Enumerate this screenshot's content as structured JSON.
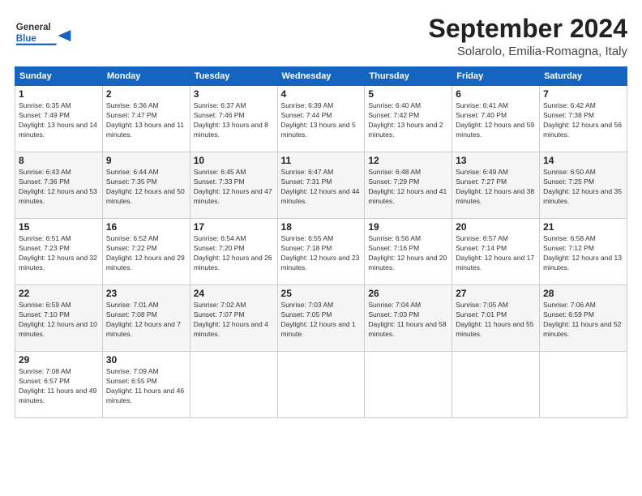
{
  "header": {
    "logo_general": "General",
    "logo_blue": "Blue",
    "month_title": "September 2024",
    "location": "Solarolo, Emilia-Romagna, Italy"
  },
  "weekdays": [
    "Sunday",
    "Monday",
    "Tuesday",
    "Wednesday",
    "Thursday",
    "Friday",
    "Saturday"
  ],
  "weeks": [
    [
      {
        "day": "1",
        "sunrise": "6:35 AM",
        "sunset": "7:49 PM",
        "daylight": "13 hours and 14 minutes."
      },
      {
        "day": "2",
        "sunrise": "6:36 AM",
        "sunset": "7:47 PM",
        "daylight": "13 hours and 11 minutes."
      },
      {
        "day": "3",
        "sunrise": "6:37 AM",
        "sunset": "7:46 PM",
        "daylight": "13 hours and 8 minutes."
      },
      {
        "day": "4",
        "sunrise": "6:39 AM",
        "sunset": "7:44 PM",
        "daylight": "13 hours and 5 minutes."
      },
      {
        "day": "5",
        "sunrise": "6:40 AM",
        "sunset": "7:42 PM",
        "daylight": "13 hours and 2 minutes."
      },
      {
        "day": "6",
        "sunrise": "6:41 AM",
        "sunset": "7:40 PM",
        "daylight": "12 hours and 59 minutes."
      },
      {
        "day": "7",
        "sunrise": "6:42 AM",
        "sunset": "7:38 PM",
        "daylight": "12 hours and 56 minutes."
      }
    ],
    [
      {
        "day": "8",
        "sunrise": "6:43 AM",
        "sunset": "7:36 PM",
        "daylight": "12 hours and 53 minutes."
      },
      {
        "day": "9",
        "sunrise": "6:44 AM",
        "sunset": "7:35 PM",
        "daylight": "12 hours and 50 minutes."
      },
      {
        "day": "10",
        "sunrise": "6:45 AM",
        "sunset": "7:33 PM",
        "daylight": "12 hours and 47 minutes."
      },
      {
        "day": "11",
        "sunrise": "6:47 AM",
        "sunset": "7:31 PM",
        "daylight": "12 hours and 44 minutes."
      },
      {
        "day": "12",
        "sunrise": "6:48 AM",
        "sunset": "7:29 PM",
        "daylight": "12 hours and 41 minutes."
      },
      {
        "day": "13",
        "sunrise": "6:49 AM",
        "sunset": "7:27 PM",
        "daylight": "12 hours and 38 minutes."
      },
      {
        "day": "14",
        "sunrise": "6:50 AM",
        "sunset": "7:25 PM",
        "daylight": "12 hours and 35 minutes."
      }
    ],
    [
      {
        "day": "15",
        "sunrise": "6:51 AM",
        "sunset": "7:23 PM",
        "daylight": "12 hours and 32 minutes."
      },
      {
        "day": "16",
        "sunrise": "6:52 AM",
        "sunset": "7:22 PM",
        "daylight": "12 hours and 29 minutes."
      },
      {
        "day": "17",
        "sunrise": "6:54 AM",
        "sunset": "7:20 PM",
        "daylight": "12 hours and 26 minutes."
      },
      {
        "day": "18",
        "sunrise": "6:55 AM",
        "sunset": "7:18 PM",
        "daylight": "12 hours and 23 minutes."
      },
      {
        "day": "19",
        "sunrise": "6:56 AM",
        "sunset": "7:16 PM",
        "daylight": "12 hours and 20 minutes."
      },
      {
        "day": "20",
        "sunrise": "6:57 AM",
        "sunset": "7:14 PM",
        "daylight": "12 hours and 17 minutes."
      },
      {
        "day": "21",
        "sunrise": "6:58 AM",
        "sunset": "7:12 PM",
        "daylight": "12 hours and 13 minutes."
      }
    ],
    [
      {
        "day": "22",
        "sunrise": "6:59 AM",
        "sunset": "7:10 PM",
        "daylight": "12 hours and 10 minutes."
      },
      {
        "day": "23",
        "sunrise": "7:01 AM",
        "sunset": "7:08 PM",
        "daylight": "12 hours and 7 minutes."
      },
      {
        "day": "24",
        "sunrise": "7:02 AM",
        "sunset": "7:07 PM",
        "daylight": "12 hours and 4 minutes."
      },
      {
        "day": "25",
        "sunrise": "7:03 AM",
        "sunset": "7:05 PM",
        "daylight": "12 hours and 1 minute."
      },
      {
        "day": "26",
        "sunrise": "7:04 AM",
        "sunset": "7:03 PM",
        "daylight": "11 hours and 58 minutes."
      },
      {
        "day": "27",
        "sunrise": "7:05 AM",
        "sunset": "7:01 PM",
        "daylight": "11 hours and 55 minutes."
      },
      {
        "day": "28",
        "sunrise": "7:06 AM",
        "sunset": "6:59 PM",
        "daylight": "11 hours and 52 minutes."
      }
    ],
    [
      {
        "day": "29",
        "sunrise": "7:08 AM",
        "sunset": "6:57 PM",
        "daylight": "11 hours and 49 minutes."
      },
      {
        "day": "30",
        "sunrise": "7:09 AM",
        "sunset": "6:55 PM",
        "daylight": "11 hours and 46 minutes."
      },
      null,
      null,
      null,
      null,
      null
    ]
  ],
  "labels": {
    "sunrise_prefix": "Sunrise: ",
    "sunset_prefix": "Sunset: ",
    "daylight_prefix": "Daylight: "
  }
}
